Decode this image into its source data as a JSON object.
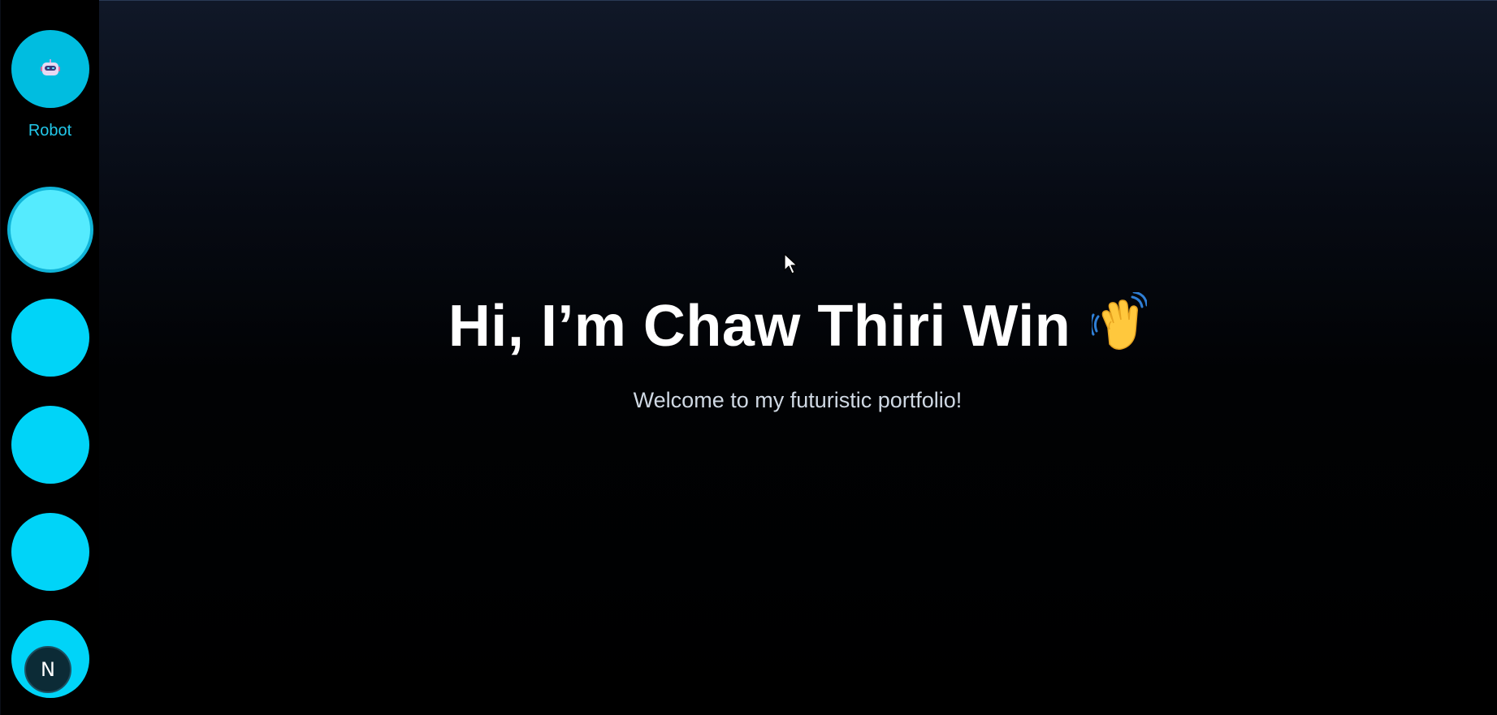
{
  "sidebar": {
    "robot": {
      "label": "Robot",
      "icon": "robot-icon"
    },
    "buttons": [
      {
        "state": "active"
      },
      {
        "state": "default"
      },
      {
        "state": "default"
      },
      {
        "state": "default"
      },
      {
        "state": "default",
        "badge": "N"
      }
    ]
  },
  "hero": {
    "title": "Hi, I’m Chaw Thiri Win",
    "wave_icon": "waving-hand-icon",
    "subtitle": "Welcome to my futuristic portfolio!"
  },
  "colors": {
    "accent": "#00d4f8",
    "active_button": "#55ebfe",
    "label": "#22c8ea",
    "title": "#ffffff",
    "subtitle": "#cfd8e3"
  }
}
